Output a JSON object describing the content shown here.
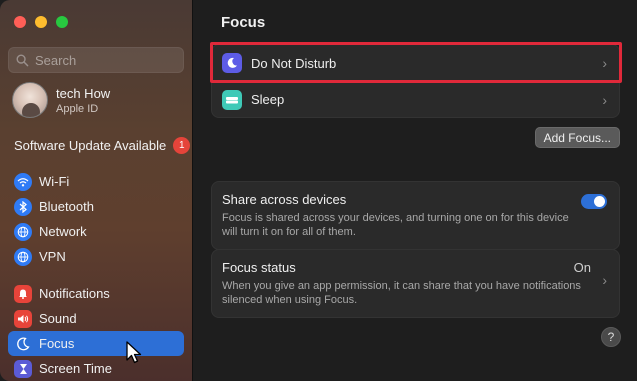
{
  "window": {
    "title": "Focus"
  },
  "search": {
    "placeholder": "Search"
  },
  "account": {
    "name": "tech How",
    "subtitle": "Apple ID"
  },
  "software_update": {
    "label": "Software Update Available",
    "badge": "1"
  },
  "sidebar": {
    "items": [
      {
        "label": "Wi-Fi",
        "icon": "wifi-icon",
        "color": "#2f7bf6"
      },
      {
        "label": "Bluetooth",
        "icon": "bluetooth-icon",
        "color": "#2f7bf6"
      },
      {
        "label": "Network",
        "icon": "globe-icon",
        "color": "#2f7bf6"
      },
      {
        "label": "VPN",
        "icon": "vpn-globe-icon",
        "color": "#2f7bf6"
      },
      {
        "label": "Notifications",
        "icon": "bell-icon",
        "color": "#e8443a"
      },
      {
        "label": "Sound",
        "icon": "speaker-icon",
        "color": "#e8443a"
      },
      {
        "label": "Focus",
        "icon": "moon-icon",
        "color": "#5b5bd6",
        "active": true
      },
      {
        "label": "Screen Time",
        "icon": "hourglass-icon",
        "color": "#5b5bd6"
      }
    ]
  },
  "focus_modes": [
    {
      "label": "Do Not Disturb",
      "icon": "moon-icon",
      "color": "#5d5ce6"
    },
    {
      "label": "Sleep",
      "icon": "bed-icon",
      "color": "#3fc9b7"
    }
  ],
  "add_focus": {
    "label": "Add Focus..."
  },
  "share": {
    "title": "Share across devices",
    "description": "Focus is shared across your devices, and turning one on for this device will turn it on for all of them.",
    "enabled": true
  },
  "focus_status": {
    "title": "Focus status",
    "value": "On",
    "description": "When you give an app permission, it can share that you have notifications silenced when using Focus."
  },
  "help": {
    "label": "?"
  }
}
